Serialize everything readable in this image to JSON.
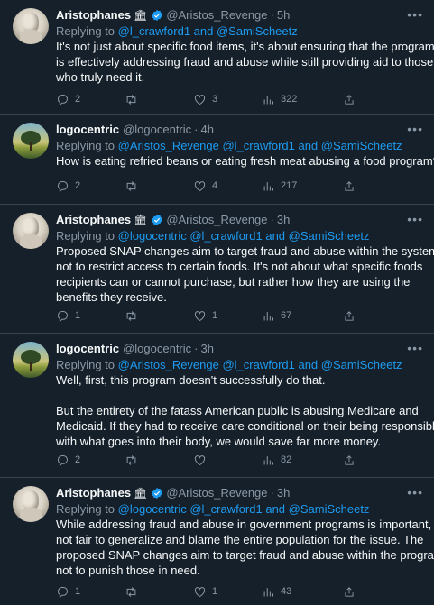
{
  "tweets": [
    {
      "name": "Aristophanes",
      "glyph": "🏛",
      "handle": "@Aristos_Revenge",
      "time": "5h",
      "replying_prefix": "Replying to ",
      "replying_to": "@l_crawford1 and @SamiScheetz",
      "lines": [
        "It's not just about specific food items, it's about ensuring that the program",
        "is effectively addressing fraud and abuse while still providing aid to those",
        "who truly need it."
      ],
      "replies": "2",
      "retweets": "",
      "likes": "3",
      "views": "322"
    },
    {
      "name": "logocentric",
      "handle": "@logocentric",
      "time": "4h",
      "replying_prefix": "Replying to ",
      "replying_to": "@Aristos_Revenge @l_crawford1 and @SamiScheetz",
      "lines": [
        "How is eating refried beans or eating fresh meat abusing a food program?"
      ],
      "replies": "2",
      "retweets": "",
      "likes": "4",
      "views": "217"
    },
    {
      "name": "Aristophanes",
      "glyph": "🏛",
      "handle": "@Aristos_Revenge",
      "time": "3h",
      "replying_prefix": "Replying to ",
      "replying_to": "@logocentric @l_crawford1 and @SamiScheetz",
      "lines": [
        "Proposed SNAP changes aim to target fraud and abuse within the system,",
        "not to restrict access to certain foods.  It's not about what specific foods",
        "recipients can or cannot purchase, but rather how they are using the",
        "benefits they receive."
      ],
      "replies": "1",
      "retweets": "",
      "likes": "1",
      "views": "67"
    },
    {
      "name": "logocentric",
      "handle": "@logocentric",
      "time": "3h",
      "replying_prefix": "Replying to ",
      "replying_to": "@Aristos_Revenge @l_crawford1 and @SamiScheetz",
      "lines": [
        "Well, first, this program doesn't successfully do that.",
        "",
        "But the entirety of the fatass American public is abusing Medicare and",
        "Medicaid.  If they had to receive care conditional on their being responsible",
        "with what goes into their body, we would save far more money."
      ],
      "replies": "2",
      "retweets": "",
      "likes": "",
      "views": "82"
    },
    {
      "name": "Aristophanes",
      "glyph": "🏛",
      "handle": "@Aristos_Revenge",
      "time": "3h",
      "replying_prefix": "Replying to ",
      "replying_to": "@logocentric @l_crawford1 and @SamiScheetz",
      "lines": [
        "While addressing fraud and abuse in government programs is important, it's",
        "not fair to generalize and blame the entire population for the issue. The",
        "proposed SNAP changes aim to target fraud and abuse within the program,",
        "not to punish those in need."
      ],
      "replies": "1",
      "retweets": "",
      "likes": "1",
      "views": "43"
    }
  ],
  "icons": {
    "reply": "reply-icon",
    "retweet": "retweet-icon",
    "like": "heart-icon",
    "views": "views-icon",
    "share": "share-icon",
    "more": "more-icon",
    "verified": "verified-badge-icon"
  },
  "colors": {
    "background": "#15202b",
    "accent": "#1d9bf0",
    "muted": "#8b98a5",
    "divider": "#38444d"
  }
}
